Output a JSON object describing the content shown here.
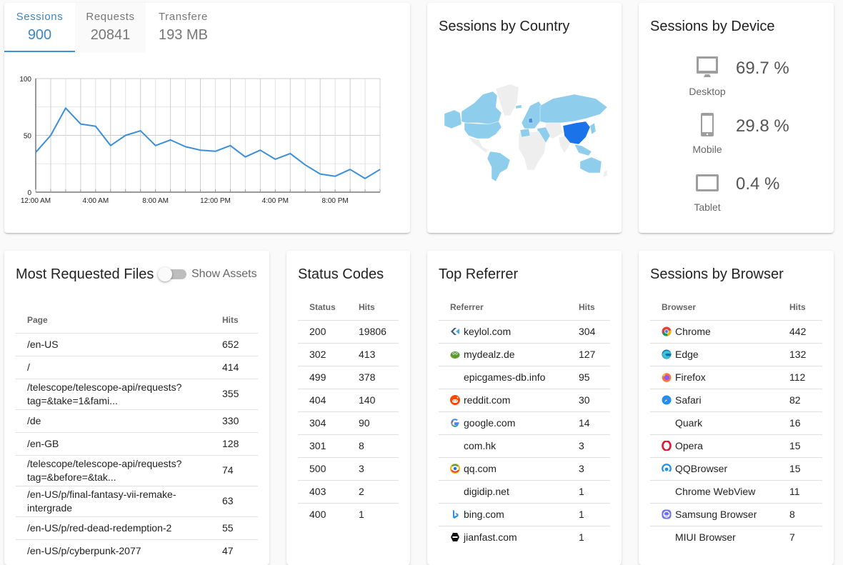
{
  "traffic": {
    "tabs": [
      {
        "label": "Sessions",
        "value": "900",
        "active": true
      },
      {
        "label": "Requests",
        "value": "20841",
        "active": false
      },
      {
        "label": "Transfere",
        "value": "193 MB",
        "active": false
      }
    ]
  },
  "chart_data": {
    "type": "line",
    "title": "",
    "xlabel": "",
    "ylabel": "",
    "x": [
      "12:00 AM",
      "1:00 AM",
      "2:00 AM",
      "3:00 AM",
      "4:00 AM",
      "5:00 AM",
      "6:00 AM",
      "7:00 AM",
      "8:00 AM",
      "9:00 AM",
      "10:00 AM",
      "11:00 AM",
      "12:00 PM",
      "1:00 PM",
      "2:00 PM",
      "3:00 PM",
      "4:00 PM",
      "5:00 PM",
      "6:00 PM",
      "7:00 PM",
      "8:00 PM",
      "9:00 PM",
      "10:00 PM",
      "11:00 PM"
    ],
    "x_tick_labels": [
      "12:00 AM",
      "4:00 AM",
      "8:00 AM",
      "12:00 PM",
      "4:00 PM",
      "8:00 PM"
    ],
    "y_tick_labels": [
      "0",
      "50",
      "100"
    ],
    "ylim": [
      0,
      100
    ],
    "grid": true,
    "series": [
      {
        "name": "Sessions",
        "color": "#3a8fd9",
        "values": [
          35,
          50,
          74,
          60,
          58,
          41,
          50,
          54,
          41,
          46,
          40,
          37,
          36,
          41,
          31,
          37,
          29,
          34,
          24,
          16,
          14,
          20,
          12,
          20
        ]
      }
    ]
  },
  "country": {
    "title": "Sessions by Country",
    "colors": {
      "none": "#eeeeee",
      "low": "#8fcdec",
      "high": "#1a73e8"
    },
    "highlighted": "China"
  },
  "device": {
    "title": "Sessions by Device",
    "items": [
      {
        "label": "Desktop",
        "percent": "69.7 %",
        "icon": "desktop-icon"
      },
      {
        "label": "Mobile",
        "percent": "29.8 %",
        "icon": "mobile-icon"
      },
      {
        "label": "Tablet",
        "percent": "0.4 %",
        "icon": "tablet-icon"
      }
    ]
  },
  "files": {
    "title": "Most Requested Files",
    "toggle_label": "Show Assets",
    "toggle_on": false,
    "columns": [
      "Page",
      "Hits"
    ],
    "rows": [
      {
        "page": "/en-US",
        "hits": "652"
      },
      {
        "page": "/",
        "hits": "414"
      },
      {
        "page": "/telescope/telescope-api/requests?tag=&take=1&fami...",
        "hits": "355"
      },
      {
        "page": "/de",
        "hits": "330"
      },
      {
        "page": "/en-GB",
        "hits": "128"
      },
      {
        "page": "/telescope/telescope-api/requests?tag=&before=&tak...",
        "hits": "74"
      },
      {
        "page": "/en-US/p/final-fantasy-vii-remake-intergrade",
        "hits": "63"
      },
      {
        "page": "/en-US/p/red-dead-redemption-2",
        "hits": "55"
      },
      {
        "page": "/en-US/p/cyberpunk-2077",
        "hits": "47"
      }
    ]
  },
  "status": {
    "title": "Status Codes",
    "columns": [
      "Status",
      "Hits"
    ],
    "rows": [
      {
        "status": "200",
        "hits": "19806"
      },
      {
        "status": "302",
        "hits": "413"
      },
      {
        "status": "499",
        "hits": "378"
      },
      {
        "status": "404",
        "hits": "140"
      },
      {
        "status": "304",
        "hits": "90"
      },
      {
        "status": "301",
        "hits": "8"
      },
      {
        "status": "500",
        "hits": "3"
      },
      {
        "status": "403",
        "hits": "2"
      },
      {
        "status": "400",
        "hits": "1"
      }
    ]
  },
  "referrer": {
    "title": "Top Referrer",
    "columns": [
      "Referrer",
      "Hits"
    ],
    "rows": [
      {
        "name": "keylol.com",
        "hits": "304",
        "icon": "keylol-icon"
      },
      {
        "name": "mydealz.de",
        "hits": "127",
        "icon": "mydealz-icon"
      },
      {
        "name": "epicgames-db.info",
        "hits": "95",
        "icon": ""
      },
      {
        "name": "reddit.com",
        "hits": "30",
        "icon": "reddit-icon"
      },
      {
        "name": "google.com",
        "hits": "14",
        "icon": "google-icon"
      },
      {
        "name": "com.hk",
        "hits": "3",
        "icon": ""
      },
      {
        "name": "qq.com",
        "hits": "3",
        "icon": "qq-icon"
      },
      {
        "name": "digidip.net",
        "hits": "1",
        "icon": ""
      },
      {
        "name": "bing.com",
        "hits": "1",
        "icon": "bing-icon"
      },
      {
        "name": "jianfast.com",
        "hits": "1",
        "icon": "jianfast-icon"
      }
    ]
  },
  "browser": {
    "title": "Sessions by Browser",
    "columns": [
      "Browser",
      "Hits"
    ],
    "rows": [
      {
        "name": "Chrome",
        "hits": "442",
        "icon": "chrome-icon"
      },
      {
        "name": "Edge",
        "hits": "132",
        "icon": "edge-icon"
      },
      {
        "name": "Firefox",
        "hits": "112",
        "icon": "firefox-icon"
      },
      {
        "name": "Safari",
        "hits": "82",
        "icon": "safari-icon"
      },
      {
        "name": "Quark",
        "hits": "16",
        "icon": ""
      },
      {
        "name": "Opera",
        "hits": "15",
        "icon": "opera-icon"
      },
      {
        "name": "QQBrowser",
        "hits": "15",
        "icon": "qqbrowser-icon"
      },
      {
        "name": "Chrome WebView",
        "hits": "11",
        "icon": ""
      },
      {
        "name": "Samsung Browser",
        "hits": "8",
        "icon": "samsung-browser-icon"
      },
      {
        "name": "MIUI Browser",
        "hits": "7",
        "icon": ""
      }
    ]
  }
}
